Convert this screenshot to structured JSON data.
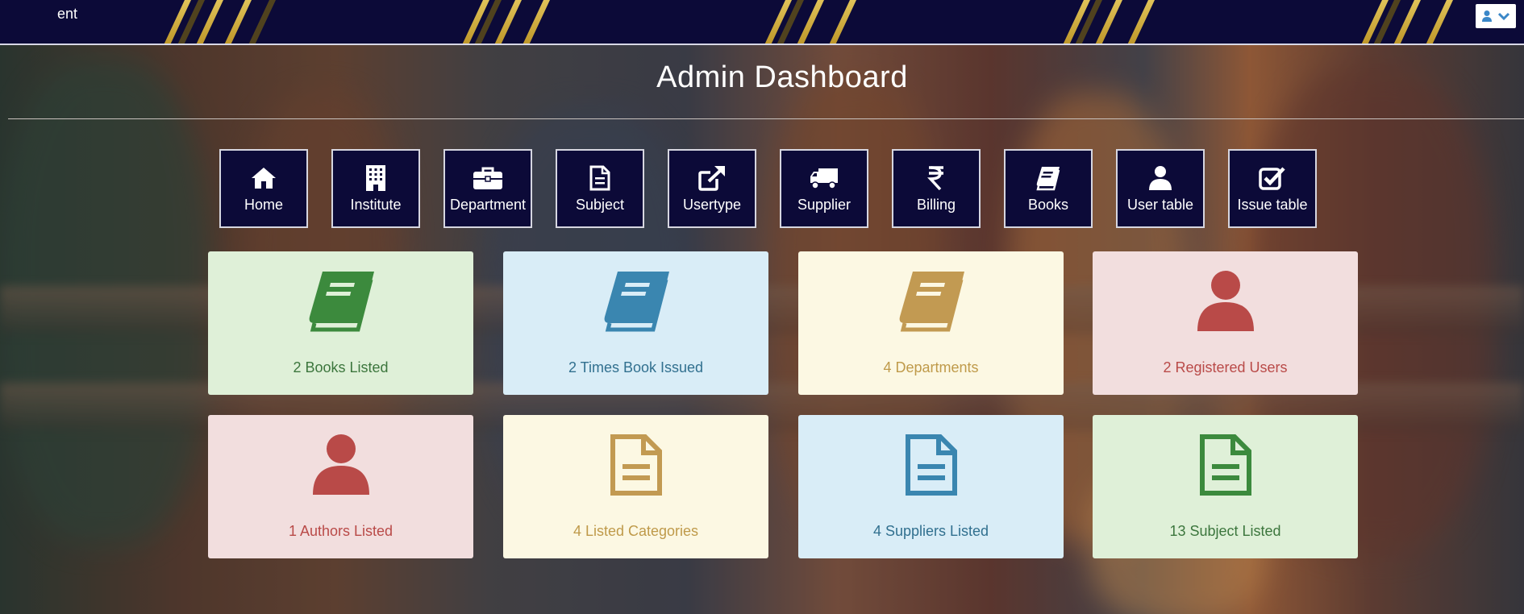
{
  "header": {
    "brand_fragment": "ent"
  },
  "page": {
    "title": "Admin Dashboard"
  },
  "nav": [
    {
      "label": "Home",
      "icon": "home-icon"
    },
    {
      "label": "Institute",
      "icon": "building-icon"
    },
    {
      "label": "Department",
      "icon": "briefcase-icon"
    },
    {
      "label": "Subject",
      "icon": "document-icon"
    },
    {
      "label": "Usertype",
      "icon": "external-link-icon"
    },
    {
      "label": "Supplier",
      "icon": "truck-icon"
    },
    {
      "label": "Billing",
      "icon": "rupee-icon"
    },
    {
      "label": "Books",
      "icon": "book-icon"
    },
    {
      "label": "User table",
      "icon": "user-icon"
    },
    {
      "label": "Issue table",
      "icon": "checkbox-icon"
    }
  ],
  "cards": [
    {
      "label": "2 Books Listed",
      "icon": "book-icon",
      "color": "#3c763d"
    },
    {
      "label": "2 Times Book Issued",
      "icon": "book-icon",
      "color": "#31708f"
    },
    {
      "label": "4 Departments",
      "icon": "book-icon",
      "color": "#c29a52"
    },
    {
      "label": "2 Registered Users",
      "icon": "user-icon",
      "color": "#b94a48"
    },
    {
      "label": "1 Authors Listed",
      "icon": "user-icon",
      "color": "#b94a48"
    },
    {
      "label": "4 Listed Categories",
      "icon": "document-icon",
      "color": "#c29a52"
    },
    {
      "label": "4 Suppliers Listed",
      "icon": "document-icon",
      "color": "#31708f"
    },
    {
      "label": "13 Subject Listed",
      "icon": "document-icon",
      "color": "#3c763d"
    }
  ],
  "colors": {
    "header_bg": "#0c0a38",
    "accent_gold": "#f2c12e"
  }
}
